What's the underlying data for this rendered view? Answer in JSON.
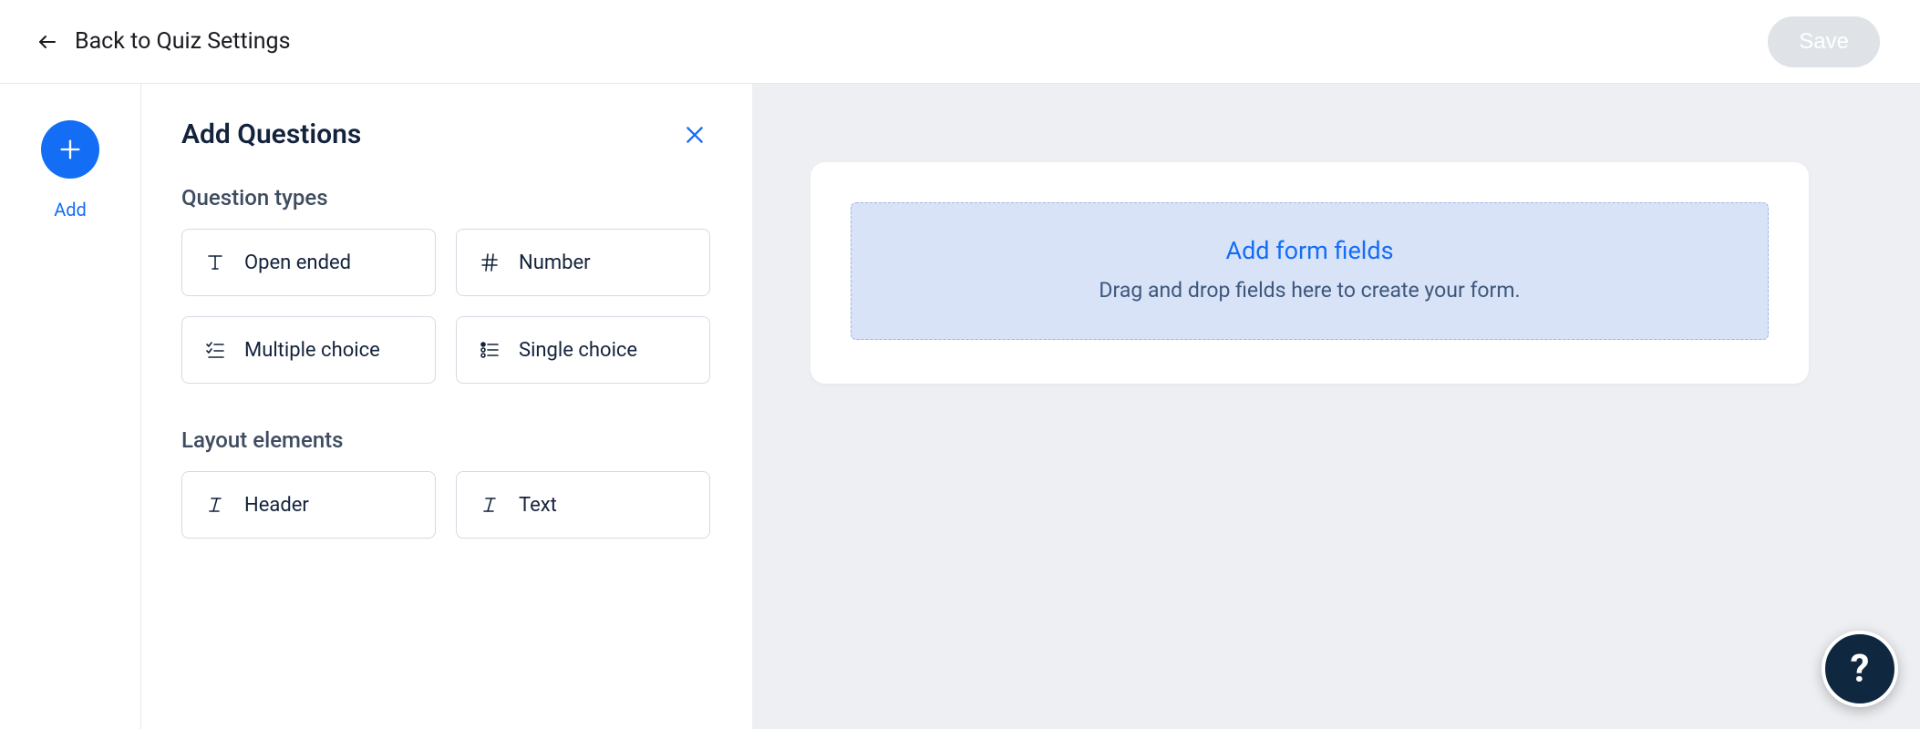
{
  "topbar": {
    "back_label": "Back to Quiz Settings",
    "save_label": "Save"
  },
  "rail": {
    "add_label": "Add"
  },
  "sidebar": {
    "title": "Add Questions",
    "section_question_types": "Question types",
    "section_layout_elements": "Layout elements",
    "tiles": {
      "open_ended": "Open ended",
      "number": "Number",
      "multiple_choice": "Multiple choice",
      "single_choice": "Single choice",
      "header": "Header",
      "text": "Text"
    }
  },
  "dropzone": {
    "title": "Add form fields",
    "subtitle": "Drag and drop fields here to create your form."
  },
  "help": {
    "glyph": "?"
  }
}
